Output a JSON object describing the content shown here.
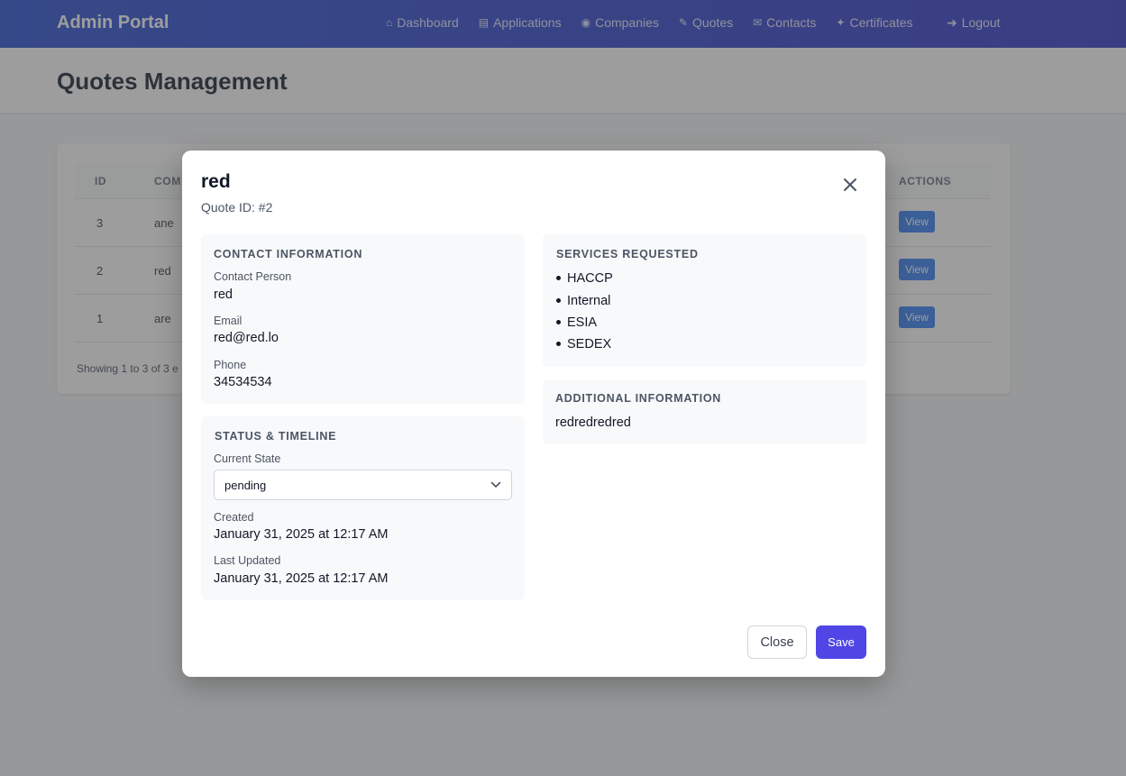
{
  "nav": {
    "brand": "Admin Portal",
    "links": [
      {
        "icon": "home-icon",
        "glyph": "⌂",
        "label": "Dashboard"
      },
      {
        "icon": "file-icon",
        "glyph": "▤",
        "label": "Applications"
      },
      {
        "icon": "building-icon",
        "glyph": "◉",
        "label": "Companies"
      },
      {
        "icon": "tag-icon",
        "glyph": "✎",
        "label": "Quotes"
      },
      {
        "icon": "envelope-icon",
        "glyph": "✉",
        "label": "Contacts"
      },
      {
        "icon": "certificate-icon",
        "glyph": "✦",
        "label": "Certificates"
      }
    ],
    "logout": {
      "icon": "logout-icon",
      "glyph": "➜",
      "label": "Logout"
    }
  },
  "page": {
    "title": "Quotes Management"
  },
  "table": {
    "headers": {
      "id": "ID",
      "company": "COM",
      "actions": "ACTIONS"
    },
    "rows": [
      {
        "id": "3",
        "company": "ane",
        "action": "View"
      },
      {
        "id": "2",
        "company": "red",
        "action": "View"
      },
      {
        "id": "1",
        "company": "are",
        "action": "View"
      }
    ],
    "showing": "Showing 1 to 3 of 3 e"
  },
  "modal": {
    "title": "red",
    "subtitle": "Quote ID: #2",
    "contact": {
      "heading": "CONTACT INFORMATION",
      "person_label": "Contact Person",
      "person": "red",
      "email_label": "Email",
      "email": "red@red.lo",
      "phone_label": "Phone",
      "phone": "34534534"
    },
    "status": {
      "heading": "STATUS & TIMELINE",
      "state_label": "Current State",
      "state": "pending",
      "created_label": "Created",
      "created": "January 31, 2025 at 12:17 AM",
      "updated_label": "Last Updated",
      "updated": "January 31, 2025 at 12:17 AM"
    },
    "services": {
      "heading": "SERVICES REQUESTED",
      "items": [
        "HACCP",
        "Internal",
        "ESIA",
        "SEDEX"
      ]
    },
    "additional": {
      "heading": "ADDITIONAL INFORMATION",
      "text": "redredredred"
    },
    "buttons": {
      "close": "Close",
      "save": "Save"
    }
  },
  "colors": {
    "nav_start": "#2f56d6",
    "nav_end": "#3b3fc9",
    "save_button": "#4f46e5",
    "view_button": "#3b82f6"
  }
}
